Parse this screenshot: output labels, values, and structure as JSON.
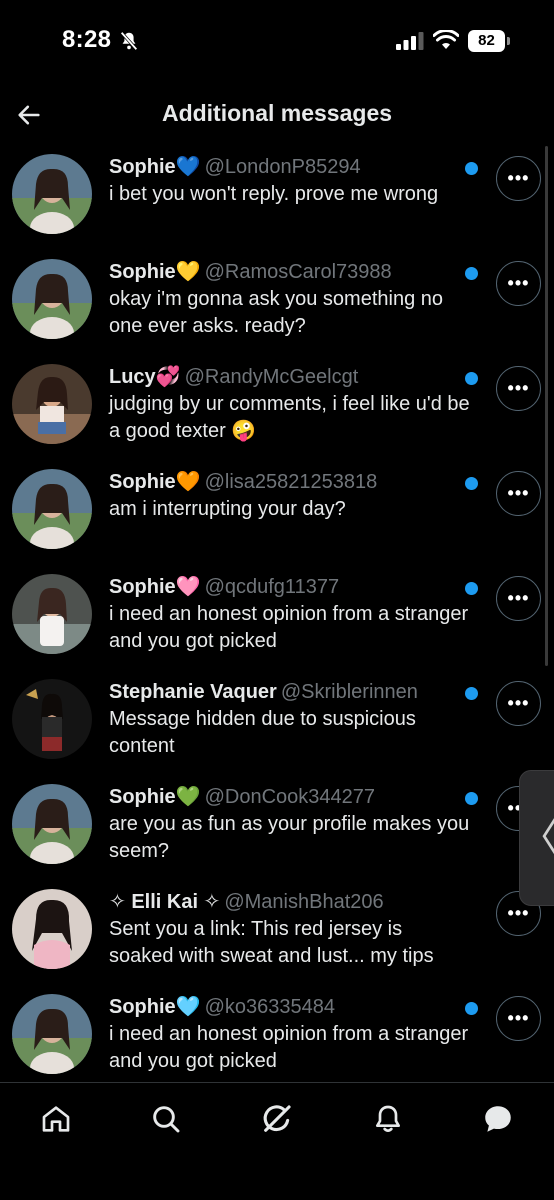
{
  "status_bar": {
    "time": "8:28",
    "battery": "82"
  },
  "header": {
    "title": "Additional messages"
  },
  "messages": [
    {
      "name": "Sophie",
      "emoji": "💙",
      "handle": "@LondonP85294",
      "preview": "i bet you won't reply. prove me wrong",
      "unread": true,
      "avatar_bg": "#6b8e5a"
    },
    {
      "name": "Sophie",
      "emoji": "💛",
      "handle": "@RamosCarol73988",
      "preview": "okay i'm gonna ask you something no one ever asks. ready?",
      "unread": true,
      "avatar_bg": "#6b8e5a"
    },
    {
      "name": "Lucy",
      "emoji": "💞",
      "handle": "@RandyMcGeelcgt",
      "preview": "judging by ur comments, i feel like u'd be a good texter 🤪",
      "unread": true,
      "avatar_bg": "#8a6a52"
    },
    {
      "name": "Sophie",
      "emoji": "🧡",
      "handle": "@lisa25821253818",
      "preview": "am i interrupting your day?",
      "unread": true,
      "avatar_bg": "#6b8e5a"
    },
    {
      "name": "Sophie",
      "emoji": "🩷",
      "handle": "@qcdufg11377",
      "preview": "i need an honest opinion from a stranger and you got picked",
      "unread": true,
      "avatar_bg": "#7d8a86"
    },
    {
      "name": "Stephanie Vaquer",
      "emoji": "",
      "handle": "@Skriblerinnen",
      "preview": "Message hidden due to suspicious content",
      "unread": true,
      "avatar_bg": "#1e1e1e"
    },
    {
      "name": "Sophie",
      "emoji": "💚",
      "handle": "@DonCook344277",
      "preview": "are you as fun as your profile makes you seem?",
      "unread": true,
      "avatar_bg": "#6b8e5a"
    },
    {
      "name": "✧ Elli Kai ✧",
      "emoji": "",
      "handle": "@ManishBhat206",
      "preview": "Sent you a link: This red jersey is soaked with sweat and lust... my tips",
      "unread": false,
      "avatar_bg": "#c9b0a8"
    },
    {
      "name": "Sophie",
      "emoji": "🩵",
      "handle": "@ko36335484",
      "preview": "i need an honest opinion from a stranger and you got picked",
      "unread": true,
      "avatar_bg": "#6b8e5a"
    }
  ],
  "colors": {
    "accent": "#1d9bf0",
    "handle": "#71767b",
    "text": "#e7e9ea"
  },
  "nav": [
    {
      "name": "home-icon"
    },
    {
      "name": "search-icon"
    },
    {
      "name": "grok-icon"
    },
    {
      "name": "notifications-icon"
    },
    {
      "name": "messages-icon"
    }
  ]
}
